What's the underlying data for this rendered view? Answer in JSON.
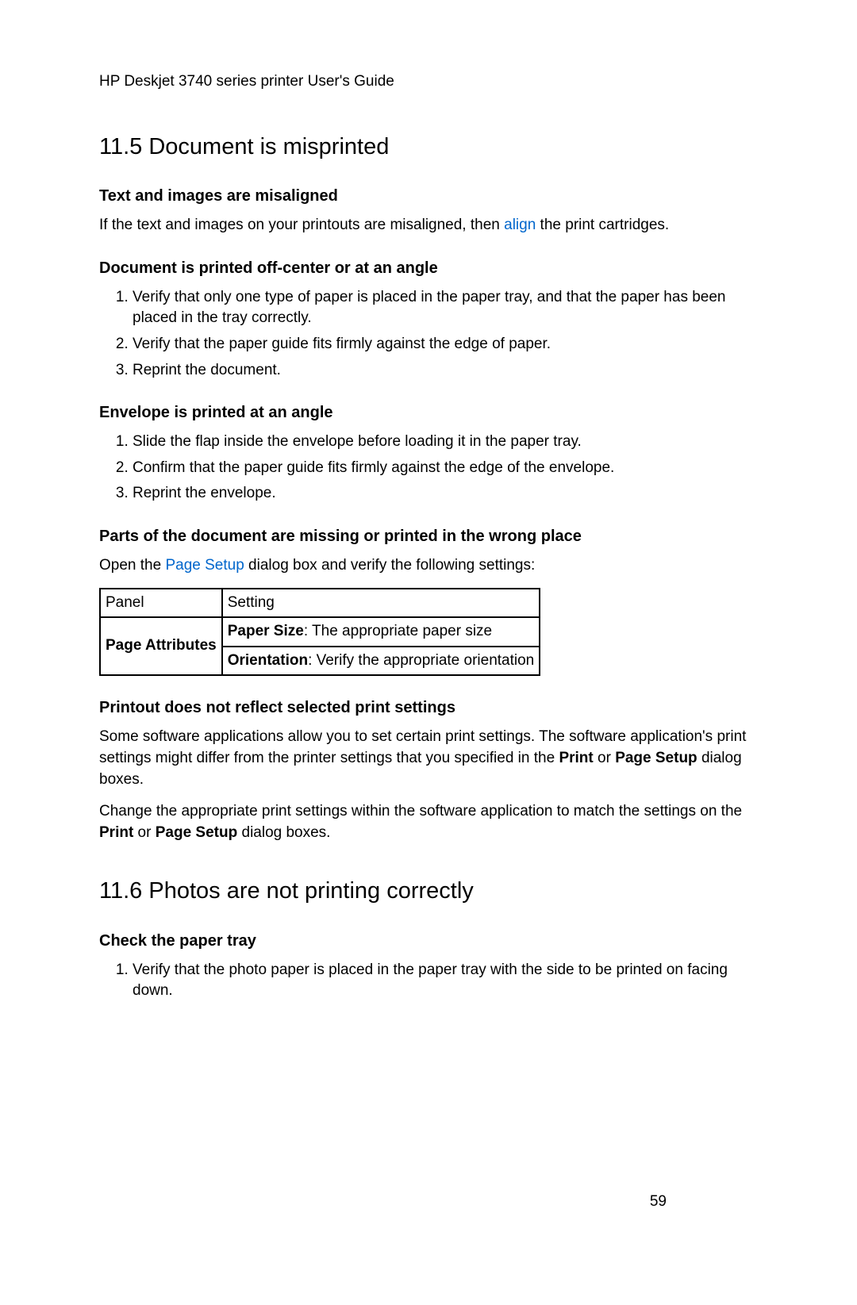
{
  "header": "HP Deskjet 3740 series printer User's Guide",
  "section1": {
    "title": "11.5  Document is misprinted",
    "sub1": {
      "heading": "Text and images are misaligned",
      "para_before": "If the text and images on your printouts are misaligned, then ",
      "link": "align",
      "para_after": " the print cartridges."
    },
    "sub2": {
      "heading": "Document is printed off-center or at an angle",
      "items": [
        "Verify that only one type of paper is placed in the paper tray, and that the paper has been placed in the tray correctly.",
        "Verify that the paper guide fits firmly against the edge of paper.",
        "Reprint the document."
      ]
    },
    "sub3": {
      "heading": "Envelope is printed at an angle",
      "items": [
        "Slide the flap inside the envelope before loading it in the paper tray.",
        "Confirm that the paper guide fits firmly against the edge of the envelope.",
        "Reprint the envelope."
      ]
    },
    "sub4": {
      "heading": "Parts of the document are missing or printed in the wrong place",
      "para_before": "Open the ",
      "link": "Page Setup",
      "para_after": " dialog box and verify the following settings:",
      "table": {
        "head1": "Panel",
        "head2": "Setting",
        "row_label": "Page Attributes",
        "cell1_bold": "Paper Size",
        "cell1_rest": ": The appropriate paper size",
        "cell2_bold": "Orientation",
        "cell2_rest": ": Verify the appropriate orientation"
      }
    },
    "sub5": {
      "heading": "Printout does not reflect selected print settings",
      "p1a": "Some software applications allow you to set certain print settings. The software application's print settings might differ from the printer settings that you specified in the ",
      "p1b": "Print",
      "p1c": " or ",
      "p1d": "Page Setup",
      "p1e": " dialog boxes.",
      "p2a": "Change the appropriate print settings within the software application to match the settings on the ",
      "p2b": "Print",
      "p2c": " or ",
      "p2d": "Page Setup",
      "p2e": " dialog boxes."
    }
  },
  "section2": {
    "title": "11.6  Photos are not printing correctly",
    "sub1": {
      "heading": "Check the paper tray",
      "items": [
        "Verify that the photo paper is placed in the paper tray with the side to be printed on facing down."
      ]
    }
  },
  "page_number": "59"
}
